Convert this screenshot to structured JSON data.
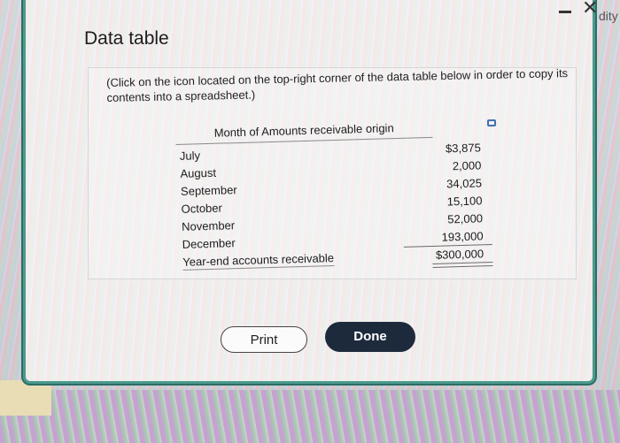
{
  "dialog": {
    "title": "Data table",
    "instruction": "(Click on the icon located on the top-right corner of the data table below in order to copy its contents into a spreadsheet.)",
    "outside_label": "dity"
  },
  "table": {
    "header": "Month of Amounts receivable origin",
    "rows": [
      {
        "label": "July",
        "value": "$3,875"
      },
      {
        "label": "August",
        "value": "2,000"
      },
      {
        "label": "September",
        "value": "34,025"
      },
      {
        "label": "October",
        "value": "15,100"
      },
      {
        "label": "November",
        "value": "52,000"
      },
      {
        "label": "December",
        "value": "193,000"
      },
      {
        "label": "Year-end accounts receivable",
        "value": "$300,000"
      }
    ]
  },
  "buttons": {
    "print": "Print",
    "done": "Done"
  },
  "window_controls": {
    "minimize": "minimize-icon",
    "close": "close-icon"
  },
  "colors": {
    "done_bg": "#1d2a3c",
    "dialog_border": "#4a9a8c",
    "copy_icon": "#3d6fb0"
  }
}
